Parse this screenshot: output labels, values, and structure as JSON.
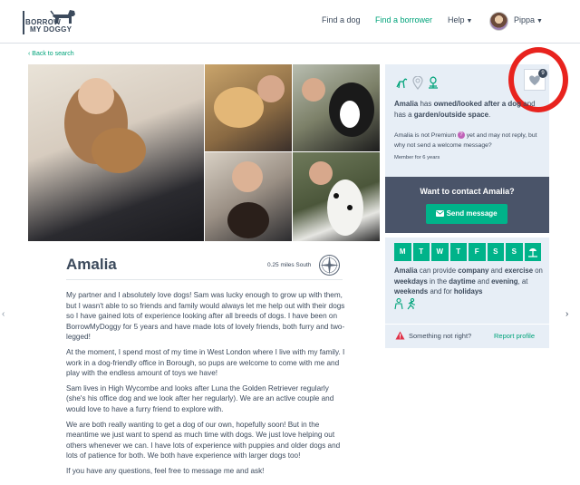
{
  "header": {
    "logo_line1": "BORROW",
    "logo_line2": "MY DOGGY",
    "nav": {
      "find_dog": "Find a dog",
      "find_borrower": "Find a borrower",
      "help": "Help"
    },
    "user_name": "Pippa"
  },
  "back_link": "Back to search",
  "profile": {
    "name": "Amalia",
    "distance": "0.25 miles South",
    "bio": [
      "My partner and I absolutely love dogs! Sam was lucky enough to grow up with them, but I wasn't able to so friends and family would always let me help out with their dogs so I have gained lots of experience looking after all breeds of dogs. I have been on BorrowMyDoggy for 5 years and have made lots of lovely friends, both furry and two-legged!",
      "At the moment, I spend most of my time in West London where I live with my family. I work in a dog-friendly office in Borough, so pups are welcome to come with me and play with the endless amount of toys we have!",
      "Sam lives in High Wycombe and looks after Luna the Golden Retriever regularly (she's his office dog and we look after her regularly). We are an active couple and would love to have a furry friend to explore with.",
      "We are both really wanting to get a dog of our own, hopefully soon! But in the meantime we just want to spend as much time with dogs. We just love helping out others whenever we can. I have lots of experience with puppies and older dogs and lots of patience for both. We both have experience with larger dogs too!",
      "If you have any questions, feel free to message me and ask!"
    ]
  },
  "sidebar": {
    "favourite_count": "9",
    "owned_name": "Amalia",
    "owned_mid1": " has ",
    "owned_bold1": "owned/looked after a dog",
    "owned_mid2": " and has a ",
    "owned_bold2": "garden/outside space",
    "owned_end": ".",
    "premium_text": "Amalia is not Premium",
    "premium_rest": " yet and may not reply, but why not send a welcome message?",
    "member_since": "Member for 6 years",
    "contact_title": "Want to contact Amalia?",
    "send_message": "Send message",
    "days": [
      "M",
      "T",
      "W",
      "T",
      "F",
      "S",
      "S"
    ],
    "avail": {
      "name": "Amalia",
      "t1": " can provide ",
      "b1": "company",
      "t2": " and ",
      "b2": "exercise",
      "t3": " on ",
      "b3": "weekdays",
      "t4": " in the ",
      "b4": "daytime",
      "t5": " and ",
      "b5": "evening",
      "t6": ", at ",
      "b6": "weekends",
      "t7": " and for ",
      "b7": "holidays"
    },
    "something_not_right": "Something not right?",
    "report_profile": "Report profile"
  },
  "colors": {
    "accent": "#00a37a",
    "button": "#00b38a",
    "dark_panel": "#4a5469",
    "panel_bg": "#e7eef6",
    "highlight_ring": "#e8231e"
  }
}
